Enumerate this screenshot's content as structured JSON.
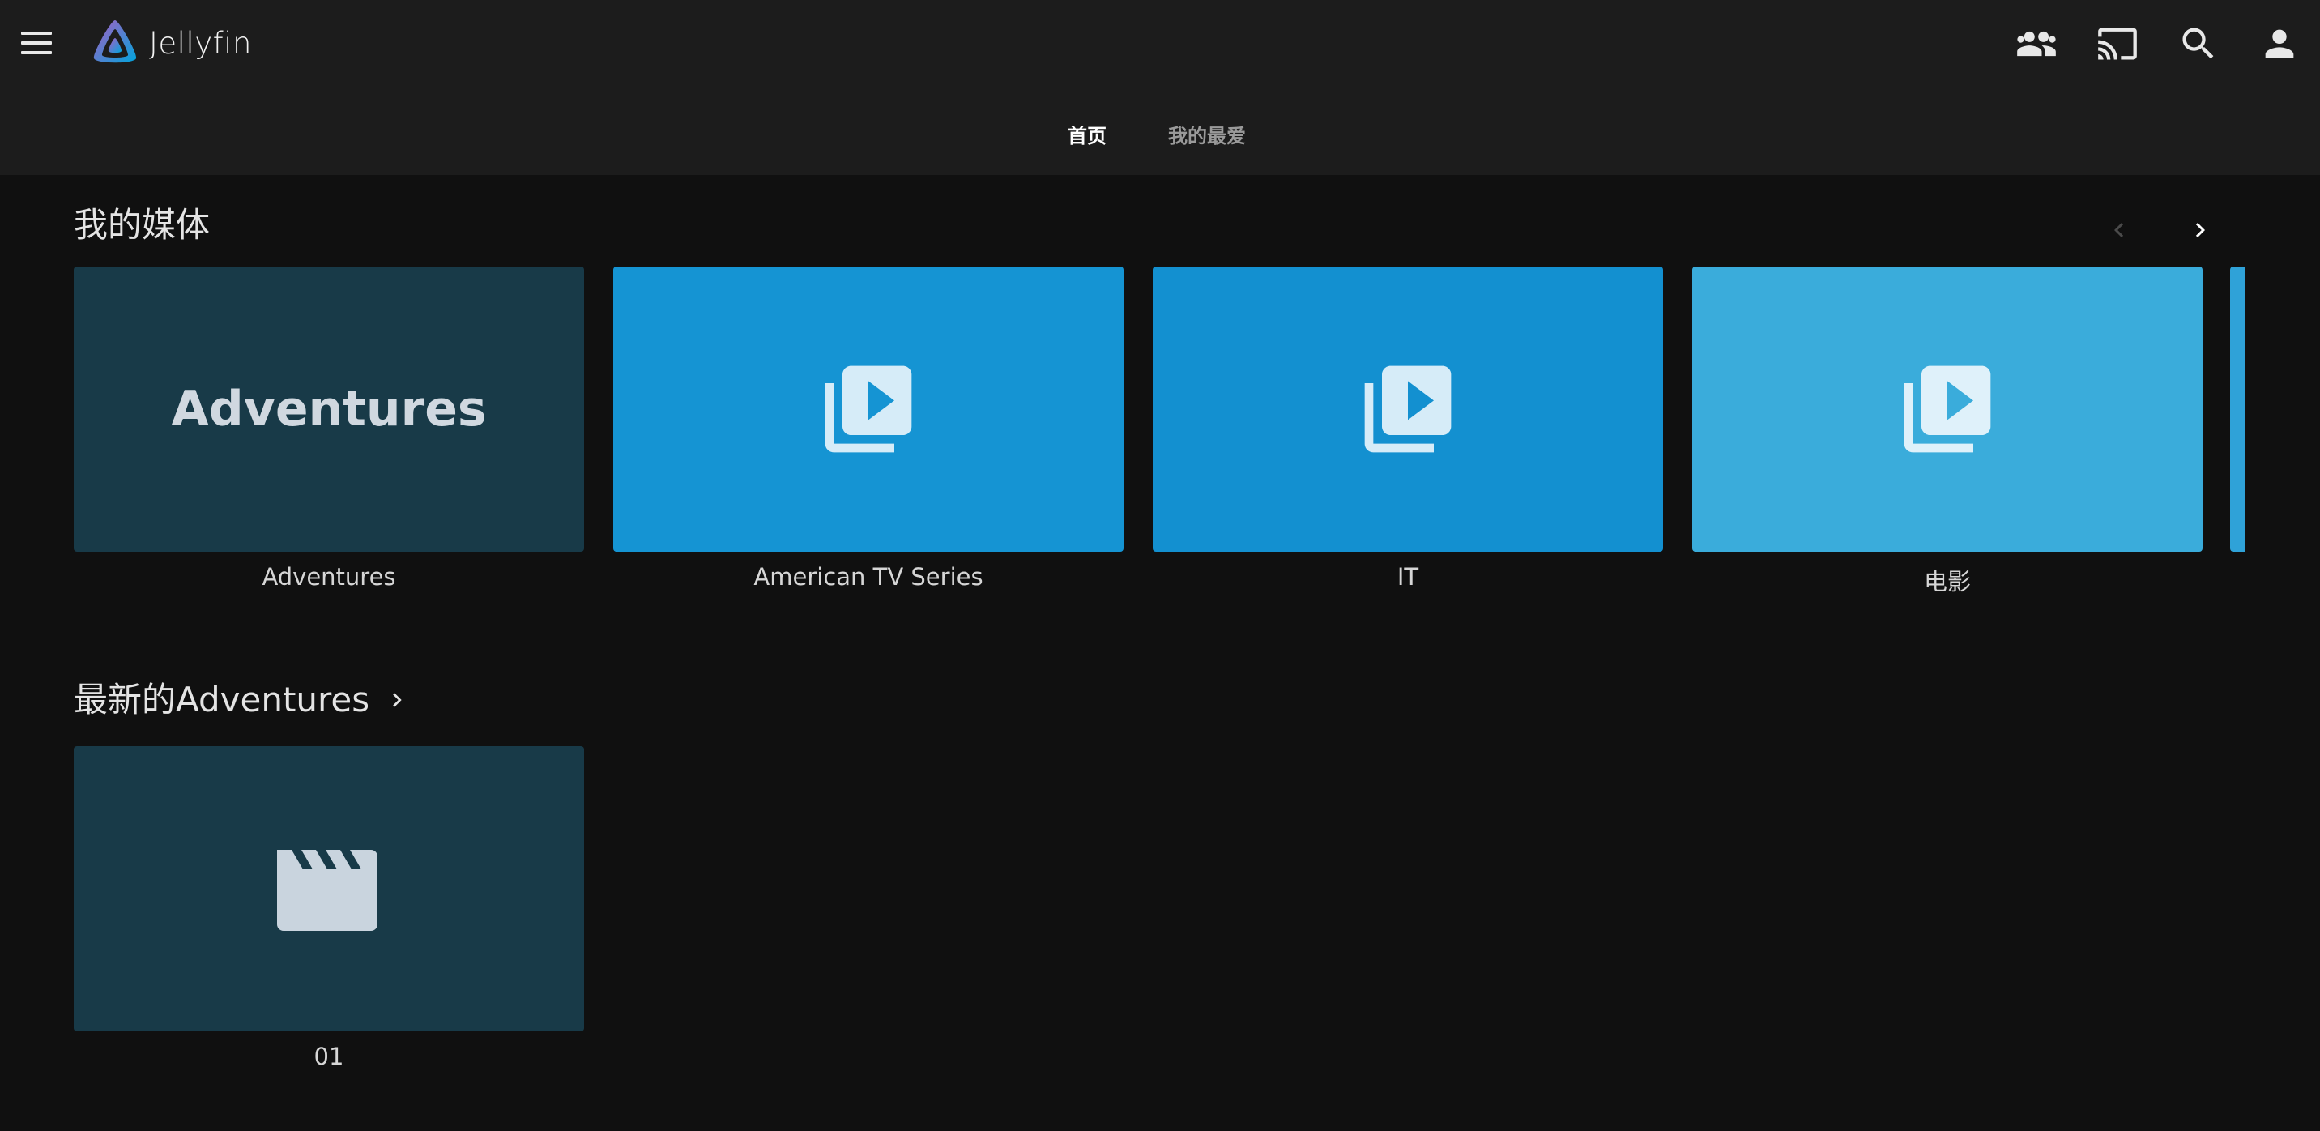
{
  "app": {
    "title": "Jellyfin"
  },
  "header": {
    "icons": [
      "users-icon",
      "cast-icon",
      "search-icon",
      "user-icon"
    ]
  },
  "tabs": [
    {
      "label": "首页",
      "active": true
    },
    {
      "label": "我的最爱",
      "active": false
    }
  ],
  "my_media": {
    "title": "我的媒体",
    "cards": [
      {
        "label": "Adventures",
        "image_text": "Adventures",
        "color": "#183a48"
      },
      {
        "label": "American TV Series",
        "color": "#1594d3"
      },
      {
        "label": "IT",
        "color": "#1390d0"
      },
      {
        "label": "电影",
        "color": "#3aacdb"
      }
    ]
  },
  "latest": {
    "title": "最新的Adventures",
    "cards": [
      {
        "label": "01",
        "color": "#183a48"
      }
    ]
  },
  "colors": {
    "header_bg": "#1c1c1c",
    "page_bg": "#101010",
    "accent_blue": "#1594d3",
    "logo_purple": "#aa5cc3",
    "logo_blue": "#00a4dc"
  }
}
